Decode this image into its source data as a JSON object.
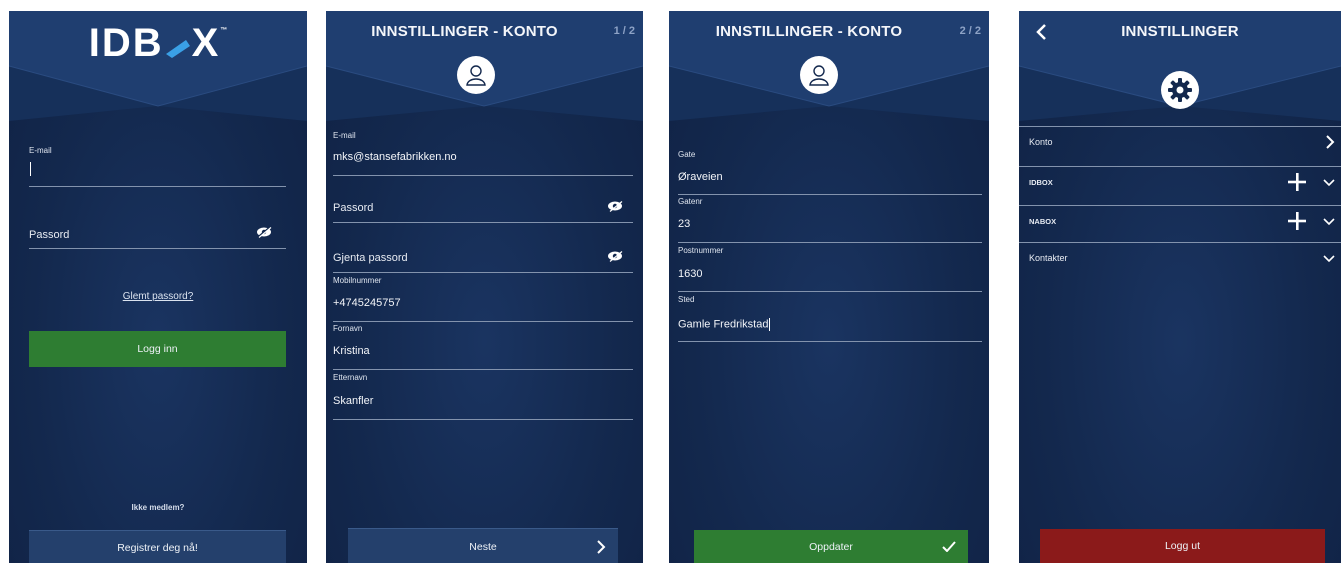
{
  "colors": {
    "background": "#13284d",
    "green_button": "#2e7d32",
    "blue_button": "#24406c",
    "red_button": "#8b1a1a",
    "field_line": "#8393ad"
  },
  "login": {
    "logo_text": "IDB",
    "logo_text_end": "X",
    "logo_tm": "™",
    "email_label": "E-mail",
    "password_placeholder": "Passord",
    "forgot_password": "Glemt passord?",
    "login_button": "Logg inn",
    "not_member": "Ikke medlem?",
    "register_button": "Registrer deg nå!"
  },
  "account_step1": {
    "title": "INNSTILLINGER - KONTO",
    "step": "1 / 2",
    "email_label": "E-mail",
    "email_value": "mks@stansefabrikken.no",
    "password_placeholder": "Passord",
    "repeat_password_placeholder": "Gjenta passord",
    "mobile_label": "Mobilnummer",
    "mobile_value": "+4745245757",
    "firstname_label": "Fornavn",
    "firstname_value": "Kristina",
    "lastname_label": "Etternavn",
    "lastname_value": "Skanfler",
    "next_button": "Neste"
  },
  "account_step2": {
    "title": "INNSTILLINGER - KONTO",
    "step": "2 / 2",
    "street_label": "Gate",
    "street_value": "Øraveien",
    "street_no_label": "Gatenr",
    "street_no_value": "23",
    "postal_label": "Postnummer",
    "postal_value": "1630",
    "place_label": "Sted",
    "place_value": "Gamle Fredrikstad",
    "update_button": "Oppdater"
  },
  "settings": {
    "title": "INNSTILLINGER",
    "items": [
      {
        "label": "Konto",
        "icon": "chevron-right-icon"
      },
      {
        "label": "IDBOX",
        "icon": "plus-icon"
      },
      {
        "label": "NABOX",
        "icon": "plus-icon"
      },
      {
        "label": "Kontakter",
        "icon": "chevron-down-icon"
      }
    ],
    "logout_button": "Logg ut"
  }
}
